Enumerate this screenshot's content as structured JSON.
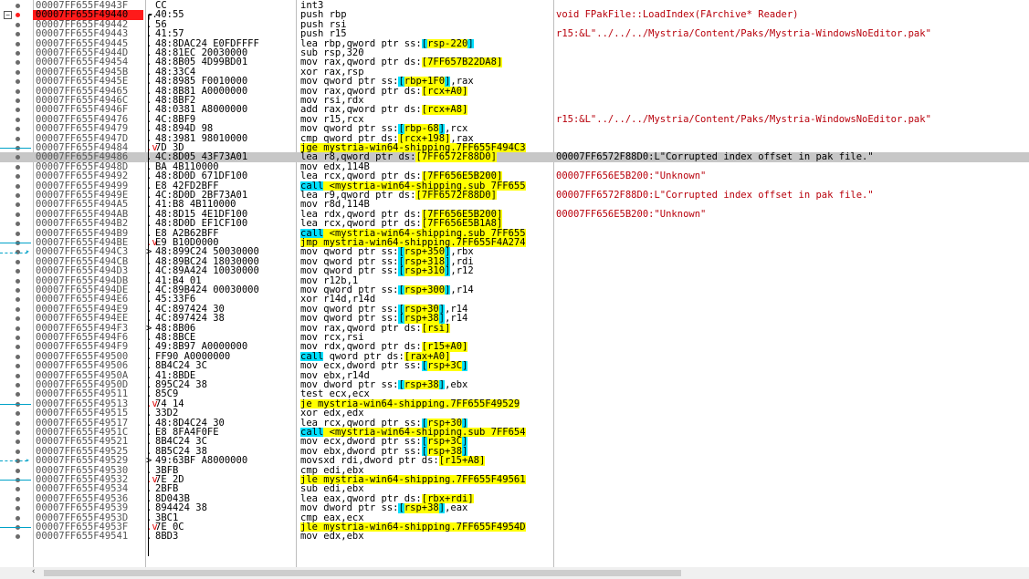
{
  "window": {
    "kind": "disassembly-view"
  },
  "breakpoint_marker": "red-dot-icon",
  "scroll_left_glyph": "‹",
  "rows": [
    {
      "addr": "00007FF655F4943F",
      "mark": "",
      "bytes": "CC",
      "instr": [
        {
          "t": "int3"
        }
      ],
      "cmt": ""
    },
    {
      "addr": "00007FF655F49440",
      "mark": "┌.",
      "bytes": "40:55",
      "instr": [
        {
          "t": "push rbp"
        }
      ],
      "cmt": "void FPakFile::LoadIndex(FArchive* Reader)",
      "bp": true,
      "fold": true
    },
    {
      "addr": "00007FF655F49442",
      "mark": ".",
      "bytes": "56",
      "instr": [
        {
          "t": "push rsi"
        }
      ],
      "cmt": ""
    },
    {
      "addr": "00007FF655F49443",
      "mark": ".",
      "bytes": "41:57",
      "instr": [
        {
          "t": "push r15"
        }
      ],
      "cmt": "r15:&L\"../../../Mystria/Content/Paks/Mystria-WindowsNoEditor.pak\""
    },
    {
      "addr": "00007FF655F49445",
      "mark": ".",
      "bytes": "48:8DAC24 E0FDFFFF",
      "instr": [
        {
          "t": "lea rbp,qword ptr ss:"
        },
        {
          "t": "[",
          "s": "c"
        },
        {
          "t": "rsp-220",
          "s": "y"
        },
        {
          "t": "]",
          "s": "c"
        }
      ],
      "cmt": ""
    },
    {
      "addr": "00007FF655F4944D",
      "mark": ".",
      "bytes": "48:81EC 20030000",
      "instr": [
        {
          "t": "sub rsp,320"
        }
      ],
      "cmt": ""
    },
    {
      "addr": "00007FF655F49454",
      "mark": ".",
      "bytes": "48:8B05 4D99BD01",
      "instr": [
        {
          "t": "mov rax,qword ptr ds:"
        },
        {
          "t": "[7FF657B22DA8]",
          "s": "y"
        }
      ],
      "cmt": ""
    },
    {
      "addr": "00007FF655F4945B",
      "mark": ".",
      "bytes": "48:33C4",
      "instr": [
        {
          "t": "xor rax,rsp"
        }
      ],
      "cmt": ""
    },
    {
      "addr": "00007FF655F4945E",
      "mark": ".",
      "bytes": "48:8985 F0010000",
      "instr": [
        {
          "t": "mov qword ptr ss:"
        },
        {
          "t": "[",
          "s": "c"
        },
        {
          "t": "rbp+1F0",
          "s": "y"
        },
        {
          "t": "]",
          "s": "c"
        },
        {
          "t": ",rax"
        }
      ],
      "cmt": ""
    },
    {
      "addr": "00007FF655F49465",
      "mark": ".",
      "bytes": "48:8B81 A0000000",
      "instr": [
        {
          "t": "mov rax,qword ptr ds:"
        },
        {
          "t": "[rcx+A0]",
          "s": "y"
        }
      ],
      "cmt": ""
    },
    {
      "addr": "00007FF655F4946C",
      "mark": ".",
      "bytes": "48:8BF2",
      "instr": [
        {
          "t": "mov rsi,rdx"
        }
      ],
      "cmt": ""
    },
    {
      "addr": "00007FF655F4946F",
      "mark": ".",
      "bytes": "48:0381 A8000000",
      "instr": [
        {
          "t": "add rax,qword ptr ds:"
        },
        {
          "t": "[rcx+A8]",
          "s": "y"
        }
      ],
      "cmt": ""
    },
    {
      "addr": "00007FF655F49476",
      "mark": ".",
      "bytes": "4C:8BF9",
      "instr": [
        {
          "t": "mov r15,rcx"
        }
      ],
      "cmt": "r15:&L\"../../../Mystria/Content/Paks/Mystria-WindowsNoEditor.pak\""
    },
    {
      "addr": "00007FF655F49479",
      "mark": ".",
      "bytes": "48:894D 98",
      "instr": [
        {
          "t": "mov qword ptr ss:"
        },
        {
          "t": "[",
          "s": "c"
        },
        {
          "t": "rbp-68",
          "s": "y"
        },
        {
          "t": "]",
          "s": "c"
        },
        {
          "t": ",rcx"
        }
      ],
      "cmt": ""
    },
    {
      "addr": "00007FF655F4947D",
      "mark": ".",
      "bytes": "48:3981 98010000",
      "instr": [
        {
          "t": "cmp qword ptr ds:"
        },
        {
          "t": "[rcx+198]",
          "s": "y"
        },
        {
          "t": ",rax"
        }
      ],
      "cmt": ""
    },
    {
      "addr": "00007FF655F49484",
      "mark": ".v",
      "bytes": "7D 3D",
      "instr": [
        {
          "t": "jge mystria-win64-shipping.7FF655F494C3",
          "s": "y"
        }
      ],
      "cmt": "",
      "jump": true
    },
    {
      "addr": "00007FF655F49486",
      "mark": ".",
      "bytes": "4C:8D05 43F73A01",
      "instr": [
        {
          "t": "lea r8,qword ptr ds:"
        },
        {
          "t": "[7FF6572F88D0]",
          "s": "y"
        }
      ],
      "cmt": "00007FF6572F88D0:L\"Corrupted index offset in pak file.\"",
      "sel": true
    },
    {
      "addr": "00007FF655F4948D",
      "mark": ".",
      "bytes": "BA 4B110000",
      "instr": [
        {
          "t": "mov edx,114B"
        }
      ],
      "cmt": ""
    },
    {
      "addr": "00007FF655F49492",
      "mark": ".",
      "bytes": "48:8D0D 671DF100",
      "instr": [
        {
          "t": "lea rcx,qword ptr ds:"
        },
        {
          "t": "[7FF656E5B200]",
          "s": "y"
        }
      ],
      "cmt": "00007FF656E5B200:\"Unknown\""
    },
    {
      "addr": "00007FF655F49499",
      "mark": ".",
      "bytes": "E8 42FD2BFF",
      "instr": [
        {
          "t": "call",
          "s": "c"
        },
        {
          "t": " <mystria-win64-shipping.sub_7FF655",
          "s": "y"
        }
      ],
      "cmt": ""
    },
    {
      "addr": "00007FF655F4949E",
      "mark": ".",
      "bytes": "4C:8D0D 2BF73A01",
      "instr": [
        {
          "t": "lea r9,qword ptr ds:"
        },
        {
          "t": "[7FF6572F88D0]",
          "s": "y"
        }
      ],
      "cmt": "00007FF6572F88D0:L\"Corrupted index offset in pak file.\""
    },
    {
      "addr": "00007FF655F494A5",
      "mark": ".",
      "bytes": "41:B8 4B110000",
      "instr": [
        {
          "t": "mov r8d,114B"
        }
      ],
      "cmt": ""
    },
    {
      "addr": "00007FF655F494AB",
      "mark": ".",
      "bytes": "48:8D15 4E1DF100",
      "instr": [
        {
          "t": "lea rdx,qword ptr ds:"
        },
        {
          "t": "[7FF656E5B200]",
          "s": "y"
        }
      ],
      "cmt": "00007FF656E5B200:\"Unknown\""
    },
    {
      "addr": "00007FF655F494B2",
      "mark": ".",
      "bytes": "48:8D0D EF1CF100",
      "instr": [
        {
          "t": "lea rcx,qword ptr ds:"
        },
        {
          "t": "[7FF656E5B1A8]",
          "s": "y"
        }
      ],
      "cmt": ""
    },
    {
      "addr": "00007FF655F494B9",
      "mark": ".",
      "bytes": "E8 A2B62BFF",
      "instr": [
        {
          "t": "call",
          "s": "c"
        },
        {
          "t": " <mystria-win64-shipping.sub_7FF655",
          "s": "y"
        }
      ],
      "cmt": ""
    },
    {
      "addr": "00007FF655F494BE",
      "mark": ".v",
      "bytes": "E9 B10D0000",
      "instr": [
        {
          "t": "jmp mystria-win64-shipping.7FF655F4A274",
          "s": "y"
        }
      ],
      "cmt": "",
      "jump": true
    },
    {
      "addr": "00007FF655F494C3",
      "mark": ">",
      "bytes": "48:899C24 50030000",
      "instr": [
        {
          "t": "mov qword ptr ss:"
        },
        {
          "t": "[",
          "s": "c"
        },
        {
          "t": "rsp+350",
          "s": "y"
        },
        {
          "t": "]",
          "s": "c"
        },
        {
          "t": ",rbx"
        }
      ],
      "cmt": "",
      "target": true
    },
    {
      "addr": "00007FF655F494CB",
      "mark": ".",
      "bytes": "48:89BC24 18030000",
      "instr": [
        {
          "t": "mov qword ptr ss:"
        },
        {
          "t": "[",
          "s": "c"
        },
        {
          "t": "rsp+318",
          "s": "y"
        },
        {
          "t": "]",
          "s": "c"
        },
        {
          "t": ",rdi"
        }
      ],
      "cmt": ""
    },
    {
      "addr": "00007FF655F494D3",
      "mark": ".",
      "bytes": "4C:89A424 10030000",
      "instr": [
        {
          "t": "mov qword ptr ss:"
        },
        {
          "t": "[",
          "s": "c"
        },
        {
          "t": "rsp+310",
          "s": "y"
        },
        {
          "t": "]",
          "s": "c"
        },
        {
          "t": ",r12"
        }
      ],
      "cmt": ""
    },
    {
      "addr": "00007FF655F494DB",
      "mark": ".",
      "bytes": "41:B4 01",
      "instr": [
        {
          "t": "mov r12b,1"
        }
      ],
      "cmt": ""
    },
    {
      "addr": "00007FF655F494DE",
      "mark": ".",
      "bytes": "4C:89B424 00030000",
      "instr": [
        {
          "t": "mov qword ptr ss:"
        },
        {
          "t": "[",
          "s": "c"
        },
        {
          "t": "rsp+300",
          "s": "y"
        },
        {
          "t": "]",
          "s": "c"
        },
        {
          "t": ",r14"
        }
      ],
      "cmt": ""
    },
    {
      "addr": "00007FF655F494E6",
      "mark": ".",
      "bytes": "45:33F6",
      "instr": [
        {
          "t": "xor r14d,r14d"
        }
      ],
      "cmt": ""
    },
    {
      "addr": "00007FF655F494E9",
      "mark": ".",
      "bytes": "4C:897424 30",
      "instr": [
        {
          "t": "mov qword ptr ss:"
        },
        {
          "t": "[",
          "s": "c"
        },
        {
          "t": "rsp+30",
          "s": "y"
        },
        {
          "t": "]",
          "s": "c"
        },
        {
          "t": ",r14"
        }
      ],
      "cmt": ""
    },
    {
      "addr": "00007FF655F494EE",
      "mark": ".",
      "bytes": "4C:897424 38",
      "instr": [
        {
          "t": "mov qword ptr ss:"
        },
        {
          "t": "[",
          "s": "c"
        },
        {
          "t": "rsp+38",
          "s": "y"
        },
        {
          "t": "]",
          "s": "c"
        },
        {
          "t": ",r14"
        }
      ],
      "cmt": ""
    },
    {
      "addr": "00007FF655F494F3",
      "mark": ">",
      "bytes": "48:8B06",
      "instr": [
        {
          "t": "mov rax,qword ptr ds:"
        },
        {
          "t": "[rsi]",
          "s": "y"
        }
      ],
      "cmt": ""
    },
    {
      "addr": "00007FF655F494F6",
      "mark": ".",
      "bytes": "48:8BCE",
      "instr": [
        {
          "t": "mov rcx,rsi"
        }
      ],
      "cmt": ""
    },
    {
      "addr": "00007FF655F494F9",
      "mark": ".",
      "bytes": "49:8B97 A0000000",
      "instr": [
        {
          "t": "mov rdx,qword ptr ds:"
        },
        {
          "t": "[r15+A0]",
          "s": "y"
        }
      ],
      "cmt": ""
    },
    {
      "addr": "00007FF655F49500",
      "mark": ".",
      "bytes": "FF90 A0000000",
      "instr": [
        {
          "t": "call",
          "s": "c"
        },
        {
          "t": " qword ptr ds:"
        },
        {
          "t": "[rax+A0]",
          "s": "y"
        }
      ],
      "cmt": ""
    },
    {
      "addr": "00007FF655F49506",
      "mark": ".",
      "bytes": "8B4C24 3C",
      "instr": [
        {
          "t": "mov ecx,dword ptr ss:"
        },
        {
          "t": "[",
          "s": "c"
        },
        {
          "t": "rsp+3C",
          "s": "y"
        },
        {
          "t": "]",
          "s": "c"
        }
      ],
      "cmt": ""
    },
    {
      "addr": "00007FF655F4950A",
      "mark": ".",
      "bytes": "41:8BDE",
      "instr": [
        {
          "t": "mov ebx,r14d"
        }
      ],
      "cmt": ""
    },
    {
      "addr": "00007FF655F4950D",
      "mark": ".",
      "bytes": "895C24 38",
      "instr": [
        {
          "t": "mov dword ptr ss:"
        },
        {
          "t": "[",
          "s": "c"
        },
        {
          "t": "rsp+38",
          "s": "y"
        },
        {
          "t": "]",
          "s": "c"
        },
        {
          "t": ",ebx"
        }
      ],
      "cmt": ""
    },
    {
      "addr": "00007FF655F49511",
      "mark": ".",
      "bytes": "85C9",
      "instr": [
        {
          "t": "test ecx,ecx"
        }
      ],
      "cmt": ""
    },
    {
      "addr": "00007FF655F49513",
      "mark": ".v",
      "bytes": "74 14",
      "instr": [
        {
          "t": "je mystria-win64-shipping.7FF655F49529",
          "s": "y"
        }
      ],
      "cmt": "",
      "jump": true
    },
    {
      "addr": "00007FF655F49515",
      "mark": ".",
      "bytes": "33D2",
      "instr": [
        {
          "t": "xor edx,edx"
        }
      ],
      "cmt": ""
    },
    {
      "addr": "00007FF655F49517",
      "mark": ".",
      "bytes": "48:8D4C24 30",
      "instr": [
        {
          "t": "lea rcx,qword ptr ss:"
        },
        {
          "t": "[",
          "s": "c"
        },
        {
          "t": "rsp+30",
          "s": "y"
        },
        {
          "t": "]",
          "s": "c"
        }
      ],
      "cmt": ""
    },
    {
      "addr": "00007FF655F4951C",
      "mark": ".",
      "bytes": "E8 8FA4F0FE",
      "instr": [
        {
          "t": "call",
          "s": "c"
        },
        {
          "t": " <mystria-win64-shipping.sub_7FF654",
          "s": "y"
        }
      ],
      "cmt": ""
    },
    {
      "addr": "00007FF655F49521",
      "mark": ".",
      "bytes": "8B4C24 3C",
      "instr": [
        {
          "t": "mov ecx,dword ptr ss:"
        },
        {
          "t": "[",
          "s": "c"
        },
        {
          "t": "rsp+3C",
          "s": "y"
        },
        {
          "t": "]",
          "s": "c"
        }
      ],
      "cmt": ""
    },
    {
      "addr": "00007FF655F49525",
      "mark": ".",
      "bytes": "8B5C24 38",
      "instr": [
        {
          "t": "mov ebx,dword ptr ss:"
        },
        {
          "t": "[",
          "s": "c"
        },
        {
          "t": "rsp+38",
          "s": "y"
        },
        {
          "t": "]",
          "s": "c"
        }
      ],
      "cmt": ""
    },
    {
      "addr": "00007FF655F49529",
      "mark": ">",
      "bytes": "49:63BF A8000000",
      "instr": [
        {
          "t": "movsxd rdi,dword ptr ds:"
        },
        {
          "t": "[r15+A8]",
          "s": "y"
        }
      ],
      "cmt": "",
      "target": true
    },
    {
      "addr": "00007FF655F49530",
      "mark": ".",
      "bytes": "3BFB",
      "instr": [
        {
          "t": "cmp edi,ebx"
        }
      ],
      "cmt": ""
    },
    {
      "addr": "00007FF655F49532",
      "mark": ".v",
      "bytes": "7E 2D",
      "instr": [
        {
          "t": "jle mystria-win64-shipping.7FF655F49561",
          "s": "y"
        }
      ],
      "cmt": "",
      "jump": true
    },
    {
      "addr": "00007FF655F49534",
      "mark": ".",
      "bytes": "2BFB",
      "instr": [
        {
          "t": "sub edi,ebx"
        }
      ],
      "cmt": ""
    },
    {
      "addr": "00007FF655F49536",
      "mark": ".",
      "bytes": "8D043B",
      "instr": [
        {
          "t": "lea eax,qword ptr ds:"
        },
        {
          "t": "[rbx+rdi]",
          "s": "y"
        }
      ],
      "cmt": ""
    },
    {
      "addr": "00007FF655F49539",
      "mark": ".",
      "bytes": "894424 38",
      "instr": [
        {
          "t": "mov dword ptr ss:"
        },
        {
          "t": "[",
          "s": "c"
        },
        {
          "t": "rsp+38",
          "s": "y"
        },
        {
          "t": "]",
          "s": "c"
        },
        {
          "t": ",eax"
        }
      ],
      "cmt": ""
    },
    {
      "addr": "00007FF655F4953D",
      "mark": ".",
      "bytes": "3BC1",
      "instr": [
        {
          "t": "cmp eax,ecx"
        }
      ],
      "cmt": ""
    },
    {
      "addr": "00007FF655F4953F",
      "mark": ".v",
      "bytes": "7E 0C",
      "instr": [
        {
          "t": "jle mystria-win64-shipping.7FF655F4954D",
          "s": "y"
        }
      ],
      "cmt": "",
      "jump": true
    },
    {
      "addr": "00007FF655F49541",
      "mark": ".",
      "bytes": "8BD3",
      "instr": [
        {
          "t": "mov edx,ebx"
        }
      ],
      "cmt": ""
    }
  ]
}
